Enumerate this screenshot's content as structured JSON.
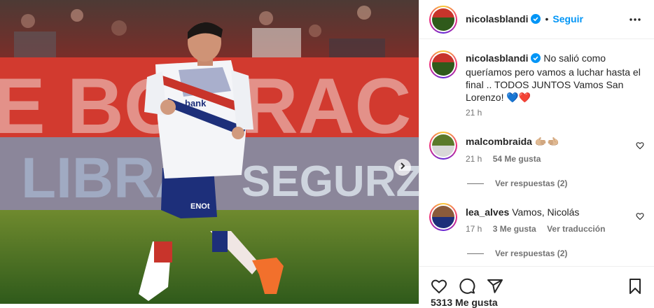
{
  "post": {
    "username": "nicolasblandi",
    "follow_label": "Seguir",
    "separator": "•"
  },
  "caption": {
    "username": "nicolasblandi",
    "text": "No salió como queríamos pero vamos a luchar hasta el final .. TODOS JUNTOS Vamos San Lorenzo! 💙❤️",
    "time": "21 h"
  },
  "comments": [
    {
      "username": "malcombraida",
      "text": "🫱🏼‍🫲🏼",
      "time": "21 h",
      "likes": "54 Me gusta",
      "view_replies": "Ver respuestas (2)"
    },
    {
      "username": "lea_alves",
      "text": "Vamos, Nicolás",
      "time": "17 h",
      "likes": "3 Me gusta",
      "translate": "Ver traducción",
      "view_replies": "Ver respuestas (2)"
    }
  ],
  "footer": {
    "likes_partial": "5313 Me gusta"
  },
  "icons": {
    "verified": "verified-badge-icon",
    "more": "more-options-icon",
    "like": "heart-icon",
    "comment": "comment-icon",
    "share": "share-icon",
    "save": "bookmark-icon",
    "next": "chevron-right-icon"
  },
  "colors": {
    "accent": "#0095f6",
    "jersey_red": "#c8342b",
    "jersey_blue": "#1d2f7a"
  }
}
